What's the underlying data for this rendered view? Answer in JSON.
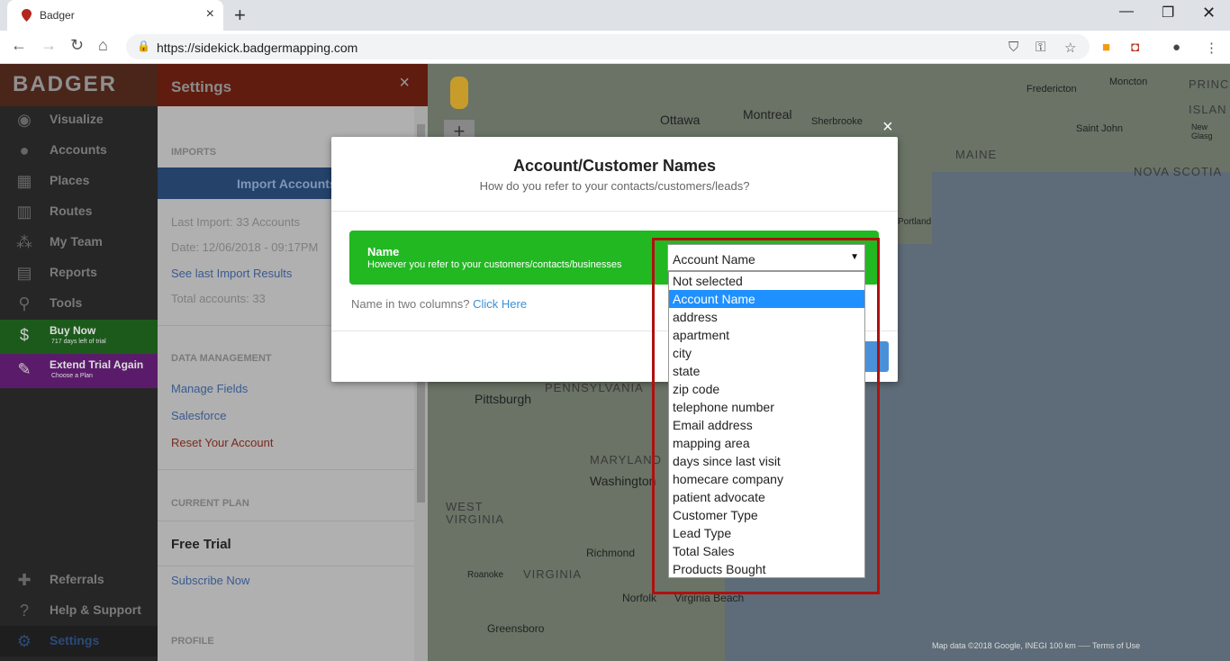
{
  "browser": {
    "tab_title": "Badger",
    "url": "https://sidekick.badgermapping.com"
  },
  "sidebar": {
    "brand": "BADGER",
    "items": [
      {
        "label": "Visualize",
        "icon": "eye-icon"
      },
      {
        "label": "Accounts",
        "icon": "user-icon"
      },
      {
        "label": "Places",
        "icon": "building-icon"
      },
      {
        "label": "Routes",
        "icon": "map-icon"
      },
      {
        "label": "My Team",
        "icon": "team-icon"
      },
      {
        "label": "Reports",
        "icon": "report-icon"
      },
      {
        "label": "Tools",
        "icon": "pin-icon"
      }
    ],
    "buy_now": {
      "label": "Buy Now",
      "sub": "717 days left of trial"
    },
    "extend_trial": {
      "label": "Extend Trial Again",
      "sub": "Choose a Plan"
    },
    "bottom_items": [
      {
        "label": "Referrals",
        "icon": "gift-icon"
      },
      {
        "label": "Help & Support",
        "icon": "question-icon"
      },
      {
        "label": "Settings",
        "icon": "gear-icon"
      }
    ]
  },
  "settings": {
    "title": "Settings",
    "imports_heading": "IMPORTS",
    "import_button": "Import Accounts",
    "last_import": "Last Import: 33 Accounts",
    "date": "Date: 12/06/2018 - 09:17PM",
    "see_last": "See last Import Results",
    "total_accounts": "Total accounts: 33",
    "data_mgmt_heading": "DATA MANAGEMENT",
    "manage_fields": "Manage Fields",
    "salesforce": "Salesforce",
    "reset": "Reset Your Account",
    "current_plan_heading": "CURRENT PLAN",
    "plan": "Free Trial",
    "subscribe": "Subscribe Now",
    "profile_heading": "PROFILE"
  },
  "map": {
    "labels": [
      "Ottawa",
      "Montreal",
      "Sherbrooke",
      "Fredericton",
      "Moncton",
      "Saint John",
      "MAINE",
      "NOVA SCOTIA",
      "PRINC",
      "ISLAN",
      "New Glasg",
      "Portland",
      "Pittsburgh",
      "PENNSYLVANIA",
      "MARYLAND",
      "Washington",
      "WEST",
      "VIRGINIA",
      "VIRGINIA",
      "Richmond",
      "Roanoke",
      "Norfolk",
      "Virginia Beach",
      "Greensboro"
    ],
    "footer": "Map data ©2018 Google, INEGI   100 km ⎯⎯⎯   Terms of Use"
  },
  "modal": {
    "title": "Account/Customer Names",
    "subtitle": "How do you refer to your contacts/customers/leads?",
    "field_name": "Name",
    "field_help": "However you refer to your customers/contacts/businesses",
    "two_columns_text": "Name in two columns?",
    "two_columns_link": "Click Here",
    "close": "×"
  },
  "select": {
    "value": "Account Name",
    "options": [
      "Not selected",
      "Account Name",
      "address",
      "apartment",
      "city",
      "state",
      "zip code",
      "telephone number",
      "Email address",
      "mapping area",
      "days since last visit",
      "homecare company",
      "patient advocate",
      "Customer Type",
      "Lead Type",
      "Total Sales",
      "Products Bought"
    ],
    "selected_index": 1
  }
}
